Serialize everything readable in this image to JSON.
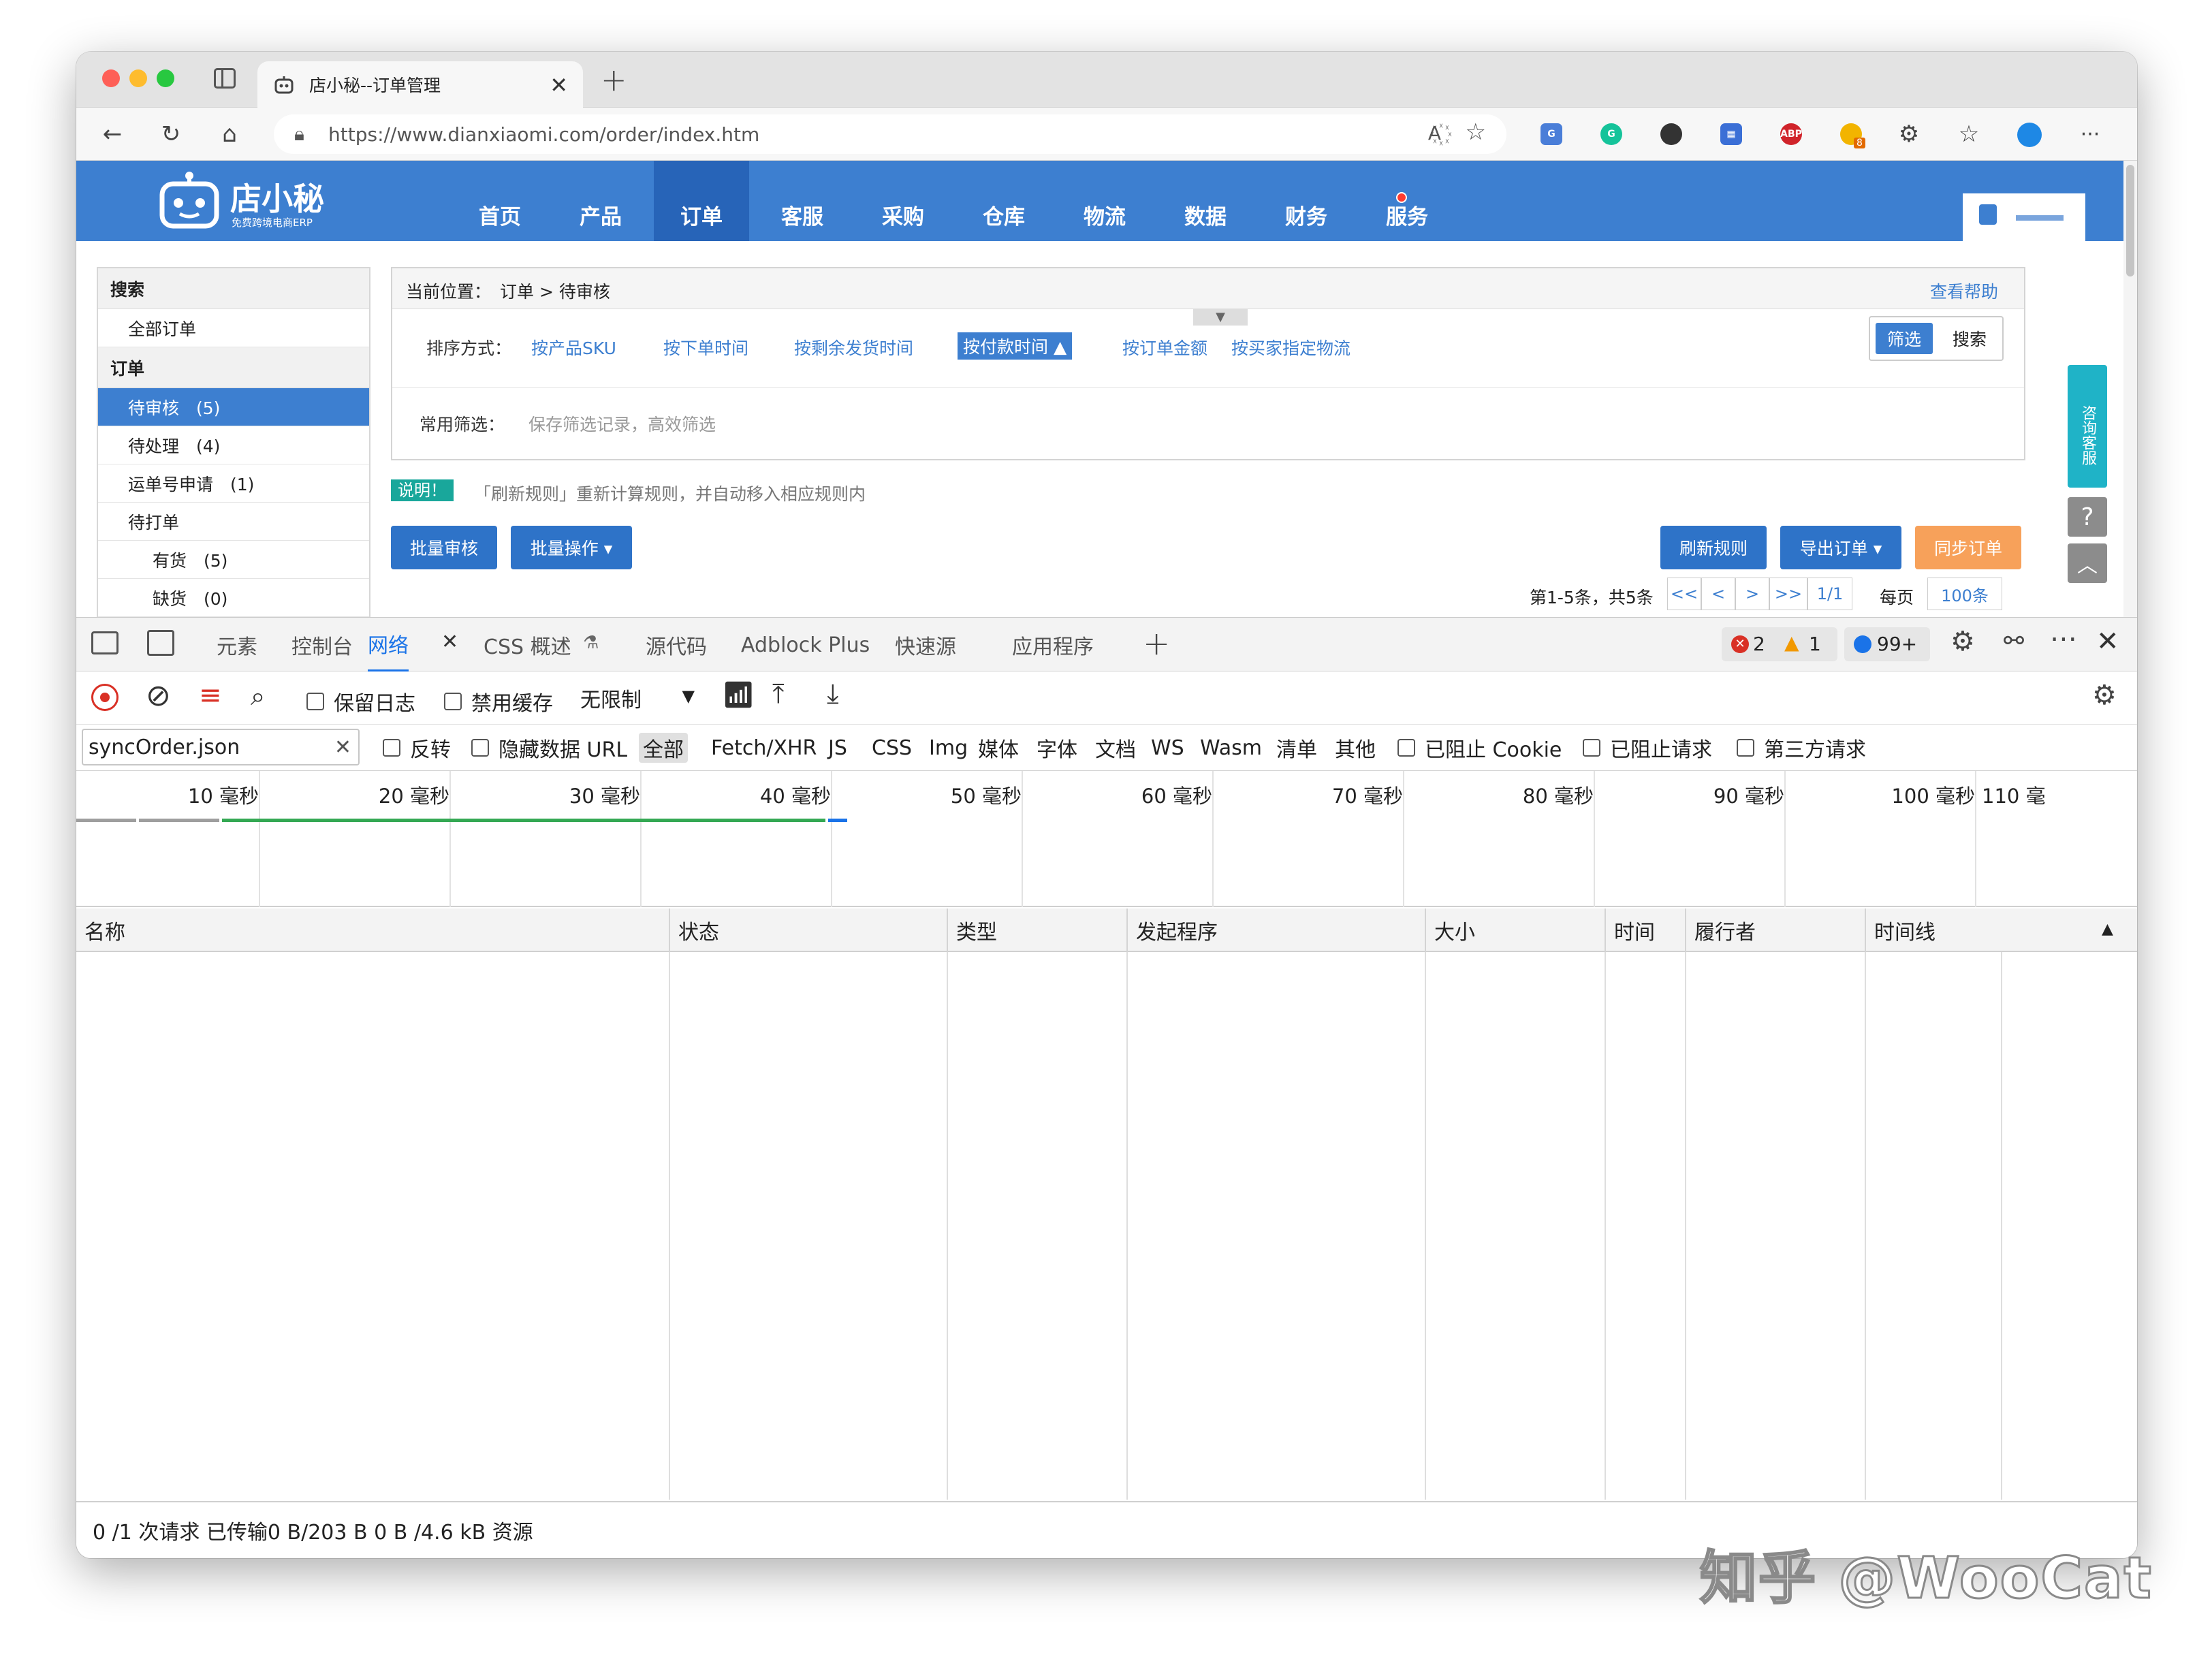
{
  "browser": {
    "tab_title": "店小秘--订单管理",
    "url": "https://www.dianxiaomi.com/order/index.htm",
    "new_tab": "+",
    "extensions": {
      "abp": "ABP",
      "badge": "8"
    },
    "menu": "···"
  },
  "site": {
    "logo_name": "店小秘",
    "logo_sub": "免费跨境电商ERP",
    "nav": [
      "首页",
      "产品",
      "订单",
      "客服",
      "采购",
      "仓库",
      "物流",
      "数据",
      "财务",
      "服务"
    ],
    "active_nav": "订单",
    "sidebar": {
      "search_header": "搜索",
      "all_orders": "全部订单",
      "order_header": "订单",
      "items": [
        {
          "label": "待审核　(5)"
        },
        {
          "label": "待处理　(4)"
        },
        {
          "label": "运单号申请　(1)"
        },
        {
          "label": "待打单"
        },
        {
          "label": "有货　(5)"
        },
        {
          "label": "缺货　(0)"
        }
      ]
    },
    "breadcrumb_prefix": "当前位置：",
    "breadcrumb": "订单 > 待审核",
    "help_link": "查看帮助",
    "sort_label": "排序方式：",
    "sort_options": [
      "按产品SKU",
      "按下单时间",
      "按剩余发货时间",
      "按付款时间 ▲",
      "按订单金额",
      "按买家指定物流"
    ],
    "filter_btn": "筛选",
    "search_btn": "搜索",
    "common_filter_label": "常用筛选：",
    "common_filter_placeholder": "保存筛选记录，高效筛选",
    "notice_tag": "说明！",
    "notice_text": "「刷新规则」重新计算规则，并自动移入相应规则内",
    "batch_review": "批量审核",
    "batch_ops": "批量操作 ▾",
    "refresh_rules": "刷新规则",
    "export_orders": "导出订单 ▾",
    "sync_orders": "同步订单",
    "pagination": {
      "summary": "第1-5条，共5条",
      "first": "<<",
      "prev": "<",
      "next": ">",
      "last": ">>",
      "page": "1/1",
      "per_page_label": "每页",
      "per_page": "100条"
    },
    "float_consult": "咨询客服"
  },
  "devtools": {
    "tabs": [
      "元素",
      "控制台",
      "网络",
      "CSS 概述",
      "源代码",
      "Adblock Plus",
      "快速源",
      "应用程序"
    ],
    "active_tab": "网络",
    "errors": "2",
    "warnings": "1",
    "messages": "99+",
    "preserve_log": "保留日志",
    "disable_cache": "禁用缓存",
    "throttle": "无限制",
    "filter_value": "syncOrder.json",
    "invert": "反转",
    "hide_data_url": "隐藏数据 URL",
    "types": [
      "全部",
      "Fetch/XHR",
      "JS",
      "CSS",
      "Img",
      "媒体",
      "字体",
      "文档",
      "WS",
      "Wasm",
      "清单",
      "其他"
    ],
    "blocked_cookies": "已阻止 Cookie",
    "blocked_requests": "已阻止请求",
    "third_party": "第三方请求",
    "ticks": [
      "10 毫秒",
      "20 毫秒",
      "30 毫秒",
      "40 毫秒",
      "50 毫秒",
      "60 毫秒",
      "70 毫秒",
      "80 毫秒",
      "90 毫秒",
      "100 毫秒",
      "110 毫"
    ],
    "columns": [
      "名称",
      "状态",
      "类型",
      "发起程序",
      "大小",
      "时间",
      "履行者",
      "时间线"
    ],
    "status_bar": "0 /1 次请求  已传输0 B/203 B  0 B /4.6 kB 资源"
  },
  "watermark": "知乎 @WooCat",
  "colors": {
    "nav_blue": "#3d7fd0",
    "accent_orange": "#f7a15a",
    "devtools_blue": "#1a73e8",
    "teal": "#19a79b"
  }
}
